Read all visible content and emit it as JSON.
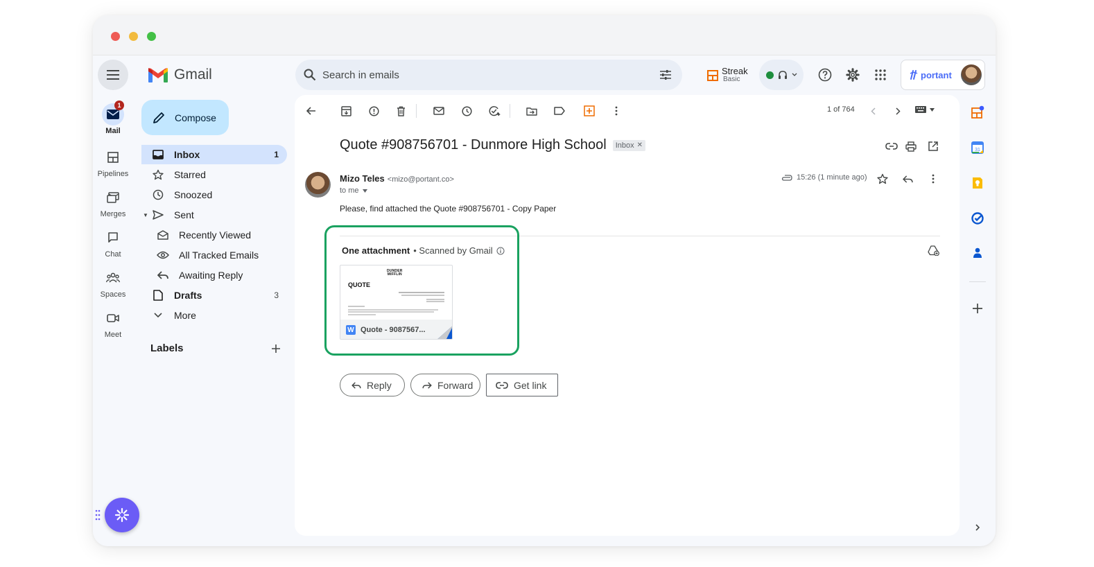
{
  "app": {
    "name": "Gmail"
  },
  "rail": {
    "mail": {
      "label": "Mail",
      "badge": "1"
    },
    "items": [
      {
        "label": "Pipelines"
      },
      {
        "label": "Merges"
      },
      {
        "label": "Chat"
      },
      {
        "label": "Spaces"
      },
      {
        "label": "Meet"
      }
    ]
  },
  "compose": {
    "label": "Compose"
  },
  "nav": {
    "inbox": {
      "label": "Inbox",
      "count": "1"
    },
    "starred": {
      "label": "Starred"
    },
    "snoozed": {
      "label": "Snoozed"
    },
    "sent": {
      "label": "Sent"
    },
    "recently_viewed": {
      "label": "Recently Viewed"
    },
    "tracked": {
      "label": "All Tracked Emails"
    },
    "awaiting": {
      "label": "Awaiting Reply"
    },
    "drafts": {
      "label": "Drafts",
      "count": "3"
    },
    "more": {
      "label": "More"
    }
  },
  "labels": {
    "title": "Labels"
  },
  "search": {
    "placeholder": "Search in emails"
  },
  "streak": {
    "name": "Streak",
    "plan": "Basic"
  },
  "portant": {
    "name": "portant"
  },
  "pagination": {
    "text": "1 of 764"
  },
  "email": {
    "subject": "Quote #908756701 - Dunmore High School",
    "label_chip": "Inbox",
    "sender_name": "Mizo Teles",
    "sender_email": "<mizo@portant.co>",
    "to": "to me",
    "time": "15:26 (1 minute ago)",
    "body": "Please, find attached the Quote #908756701 - Copy Paper"
  },
  "attachments": {
    "title": "One attachment",
    "scanned": "• Scanned by Gmail",
    "file": {
      "name": "Quote - 9087567...",
      "doc_heading": "QUOTE",
      "logo_line1": "DUNDER",
      "logo_line2": "MIFFLIN"
    }
  },
  "actions": {
    "reply": "Reply",
    "forward": "Forward",
    "get_link": "Get link"
  },
  "colors": {
    "accent_blue": "#0b57d0",
    "inbox_highlight": "#d3e3fd",
    "compose_bg": "#c2e7ff",
    "highlight_green": "#1aa260",
    "streak_orange": "#ef6c00",
    "fab_purple": "#6b5cf6"
  }
}
